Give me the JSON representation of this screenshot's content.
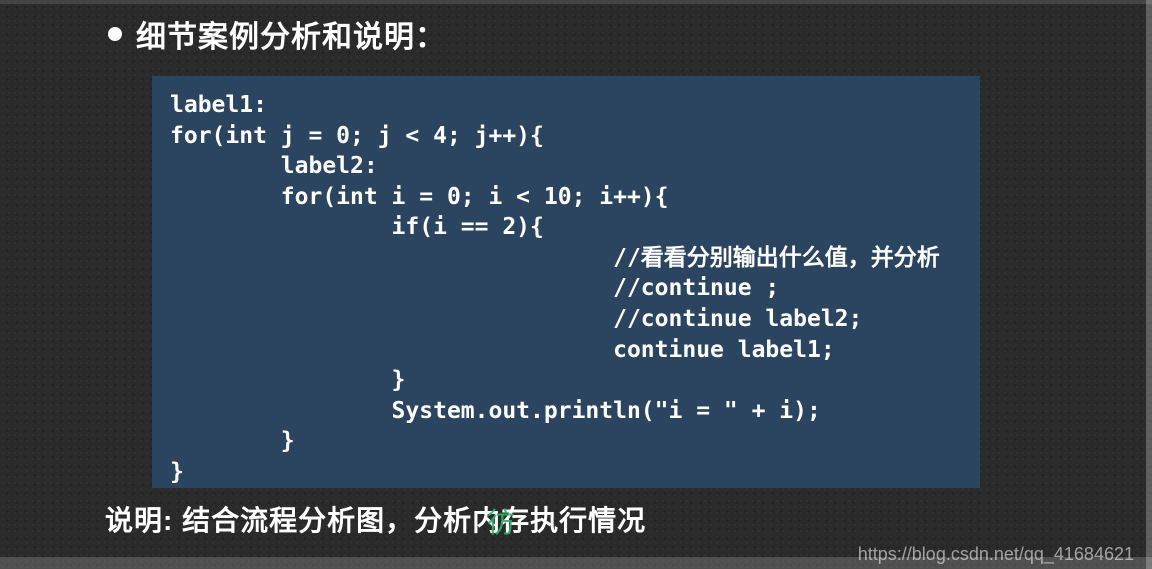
{
  "heading": "细节案例分析和说明：",
  "code_lines": {
    "l0": "label1:",
    "l1": "for(int j = 0; j < 4; j++){",
    "l2": "        label2:",
    "l3": "        for(int i = 0; i < 10; i++){",
    "l4": "                if(i == 2){",
    "l5": "                                //看看分别输出什么值，并分析",
    "l6": "                                //continue ;",
    "l7": "                                //continue label2;",
    "l8": "                                continue label1;",
    "l9": "                }",
    "l10": "                System.out.println(\"i = \" + i);",
    "l11": "        }",
    "l12": "}"
  },
  "footer_note_pre": "说明: 结合流程分析图，分析",
  "footer_note_mid": "内存",
  "footer_note_post": "执行情况",
  "watermark_char": "彷",
  "source_url": "https://blog.csdn.net/qq_41684621"
}
